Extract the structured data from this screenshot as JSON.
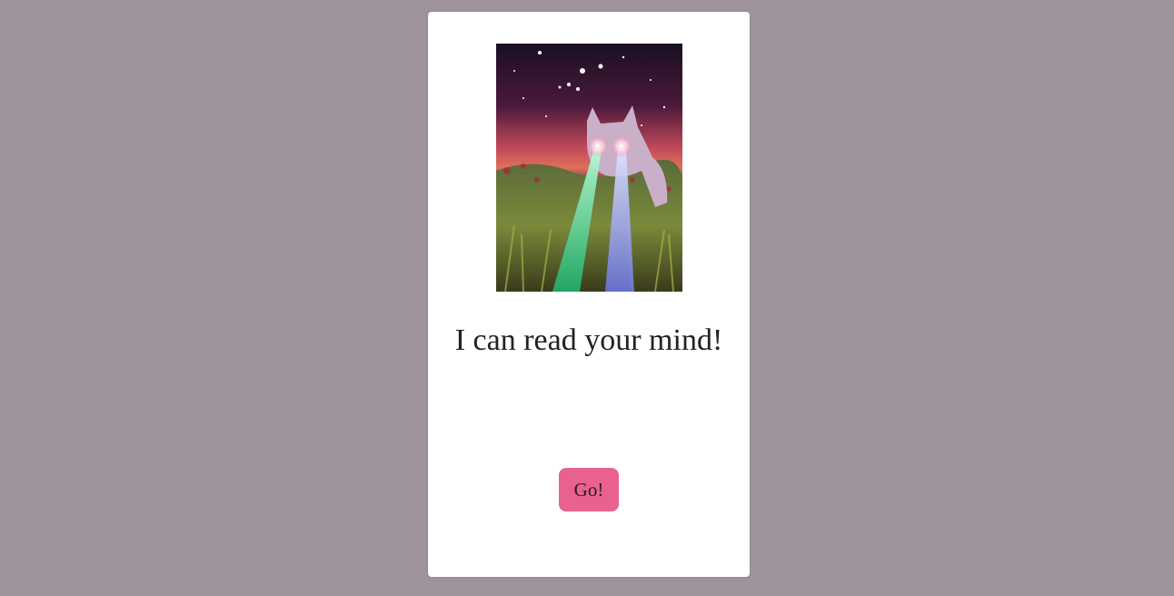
{
  "page": {
    "background_color": "#9e929b"
  },
  "card": {
    "background_color": "#ffffff",
    "image": {
      "description_icon": "laser-eyes-cat-image"
    },
    "headline": "I can read your mind!",
    "go_button": {
      "label": "Go!",
      "color": "#e9628f"
    }
  }
}
